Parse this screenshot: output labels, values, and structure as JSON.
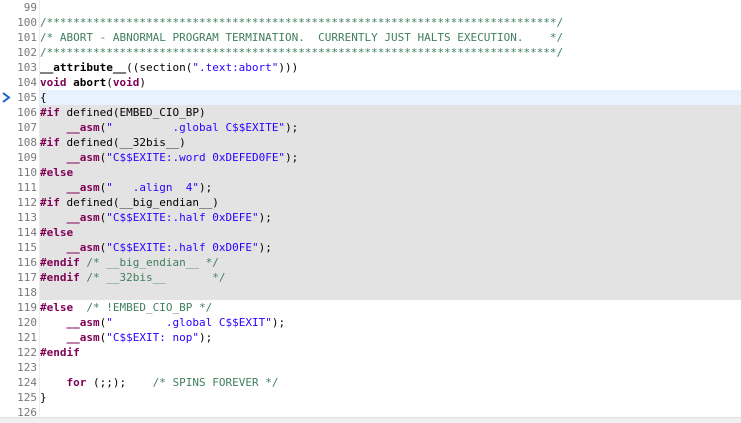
{
  "current_line_marker": "arrow-right",
  "lines": [
    {
      "n": "99",
      "tokens": []
    },
    {
      "n": "100",
      "tokens": [
        {
          "c": "cm",
          "t": "/*****************************************************************************/"
        }
      ]
    },
    {
      "n": "101",
      "tokens": [
        {
          "c": "cm",
          "t": "/* ABORT - ABNORMAL PROGRAM TERMINATION.  CURRENTLY JUST HALTS EXECUTION.    */"
        }
      ]
    },
    {
      "n": "102",
      "tokens": [
        {
          "c": "cm",
          "t": "/*****************************************************************************/"
        }
      ]
    },
    {
      "n": "103",
      "tokens": [
        {
          "c": "fn",
          "t": "__attribute__"
        },
        {
          "c": "id",
          "t": "((section("
        },
        {
          "c": "st",
          "t": "\".text:abort\""
        },
        {
          "c": "id",
          "t": ")))"
        }
      ]
    },
    {
      "n": "104",
      "tokens": [
        {
          "c": "kw",
          "t": "void"
        },
        {
          "c": "id",
          "t": " "
        },
        {
          "c": "fn",
          "t": "abort"
        },
        {
          "c": "id",
          "t": "("
        },
        {
          "c": "kw",
          "t": "void"
        },
        {
          "c": "id",
          "t": ")"
        }
      ]
    },
    {
      "n": "105",
      "tokens": [
        {
          "c": "id",
          "t": "{"
        }
      ]
    },
    {
      "n": "106",
      "tokens": [
        {
          "c": "pp",
          "t": "#if"
        },
        {
          "c": "id",
          "t": " defined(EMBED_CIO_BP)"
        }
      ]
    },
    {
      "n": "107",
      "tokens": [
        {
          "c": "id",
          "t": "    "
        },
        {
          "c": "kw",
          "t": "__asm"
        },
        {
          "c": "id",
          "t": "("
        },
        {
          "c": "st",
          "t": "\"         .global C$$EXITE\""
        },
        {
          "c": "id",
          "t": ");"
        }
      ]
    },
    {
      "n": "108",
      "tokens": [
        {
          "c": "pp",
          "t": "#if"
        },
        {
          "c": "id",
          "t": " defined(__32bis__)"
        }
      ]
    },
    {
      "n": "109",
      "tokens": [
        {
          "c": "id",
          "t": "    "
        },
        {
          "c": "kw",
          "t": "__asm"
        },
        {
          "c": "id",
          "t": "("
        },
        {
          "c": "st",
          "t": "\"C$$EXITE:.word 0xDEFED0FE\""
        },
        {
          "c": "id",
          "t": ");"
        }
      ]
    },
    {
      "n": "110",
      "tokens": [
        {
          "c": "pp",
          "t": "#else"
        }
      ]
    },
    {
      "n": "111",
      "tokens": [
        {
          "c": "id",
          "t": "    "
        },
        {
          "c": "kw",
          "t": "__asm"
        },
        {
          "c": "id",
          "t": "("
        },
        {
          "c": "st",
          "t": "\"   .align  4\""
        },
        {
          "c": "id",
          "t": ");"
        }
      ]
    },
    {
      "n": "112",
      "tokens": [
        {
          "c": "pp",
          "t": "#if"
        },
        {
          "c": "id",
          "t": " defined(__big_endian__)"
        }
      ]
    },
    {
      "n": "113",
      "tokens": [
        {
          "c": "id",
          "t": "    "
        },
        {
          "c": "kw",
          "t": "__asm"
        },
        {
          "c": "id",
          "t": "("
        },
        {
          "c": "st",
          "t": "\"C$$EXITE:.half 0xDEFE\""
        },
        {
          "c": "id",
          "t": ");"
        }
      ]
    },
    {
      "n": "114",
      "tokens": [
        {
          "c": "pp",
          "t": "#else"
        }
      ]
    },
    {
      "n": "115",
      "tokens": [
        {
          "c": "id",
          "t": "    "
        },
        {
          "c": "kw",
          "t": "__asm"
        },
        {
          "c": "id",
          "t": "("
        },
        {
          "c": "st",
          "t": "\"C$$EXITE:.half 0xD0FE\""
        },
        {
          "c": "id",
          "t": ");"
        }
      ]
    },
    {
      "n": "116",
      "tokens": [
        {
          "c": "pp",
          "t": "#endif"
        },
        {
          "c": "id",
          "t": " "
        },
        {
          "c": "cm",
          "t": "/* __big_endian__ */"
        }
      ]
    },
    {
      "n": "117",
      "tokens": [
        {
          "c": "pp",
          "t": "#endif"
        },
        {
          "c": "id",
          "t": " "
        },
        {
          "c": "cm",
          "t": "/* __32bis__       */"
        }
      ]
    },
    {
      "n": "118",
      "tokens": []
    },
    {
      "n": "119",
      "tokens": [
        {
          "c": "pp",
          "t": "#else"
        },
        {
          "c": "id",
          "t": "  "
        },
        {
          "c": "cm",
          "t": "/* !EMBED_CIO_BP */"
        }
      ]
    },
    {
      "n": "120",
      "tokens": [
        {
          "c": "id",
          "t": "    "
        },
        {
          "c": "kw",
          "t": "__asm"
        },
        {
          "c": "id",
          "t": "("
        },
        {
          "c": "st",
          "t": "\"        .global C$$EXIT\""
        },
        {
          "c": "id",
          "t": ");"
        }
      ]
    },
    {
      "n": "121",
      "tokens": [
        {
          "c": "id",
          "t": "    "
        },
        {
          "c": "kw",
          "t": "__asm"
        },
        {
          "c": "id",
          "t": "("
        },
        {
          "c": "st",
          "t": "\"C$$EXIT: nop\""
        },
        {
          "c": "id",
          "t": ");"
        }
      ]
    },
    {
      "n": "122",
      "tokens": [
        {
          "c": "pp",
          "t": "#endif"
        }
      ]
    },
    {
      "n": "123",
      "tokens": []
    },
    {
      "n": "124",
      "tokens": [
        {
          "c": "id",
          "t": "    "
        },
        {
          "c": "kw",
          "t": "for"
        },
        {
          "c": "id",
          "t": " (;;);    "
        },
        {
          "c": "cm",
          "t": "/* SPINS FOREVER */"
        }
      ]
    },
    {
      "n": "125",
      "tokens": [
        {
          "c": "id",
          "t": "}"
        }
      ]
    },
    {
      "n": "126",
      "tokens": []
    }
  ],
  "shaded_lines": [
    "106",
    "107",
    "108",
    "109",
    "110",
    "111",
    "112",
    "113",
    "114",
    "115",
    "116",
    "117",
    "118"
  ],
  "current_line": "105"
}
